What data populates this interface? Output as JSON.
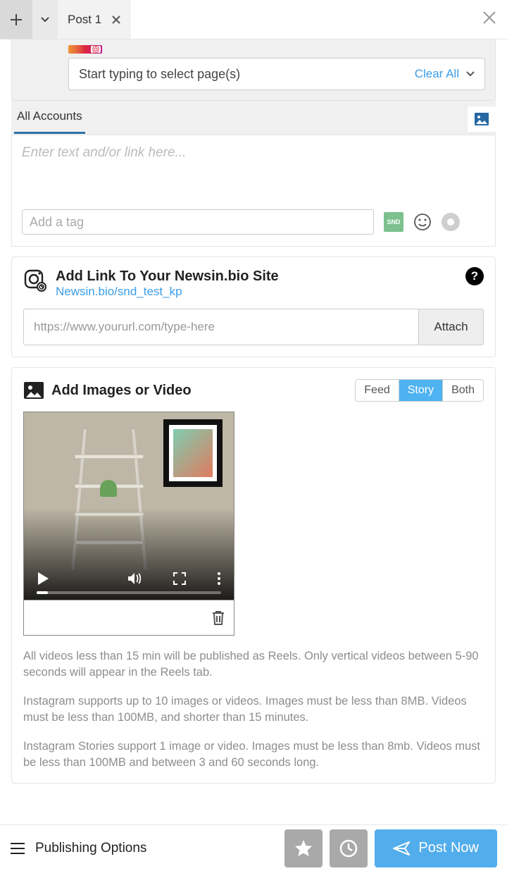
{
  "topbar": {
    "tab_label": "Post 1"
  },
  "page_selector": {
    "placeholder": "Start typing to select page(s)",
    "clear_label": "Clear All"
  },
  "tabs": {
    "all_accounts": "All Accounts"
  },
  "composer": {
    "placeholder": "Enter text and/or link here...",
    "tag_placeholder": "Add a tag",
    "snd_badge": "SND"
  },
  "link_card": {
    "title": "Add Link To Your Newsin.bio Site",
    "link_text": "Newsin.bio/snd_test_kp",
    "url_placeholder": "https://www.yoururl.com/type-here",
    "attach_label": "Attach"
  },
  "media_card": {
    "title": "Add Images or Video",
    "seg": {
      "feed": "Feed",
      "story": "Story",
      "both": "Both",
      "active": "story"
    },
    "notes": [
      "All videos less than 15 min will be published as Reels. Only vertical videos between 5-90 seconds will appear in the Reels tab.",
      "Instagram supports up to 10 images or videos. Images must be less than 8MB. Videos must be less than 100MB, and shorter than 15 minutes.",
      "Instagram Stories support 1 image or video. Images must be less than 8mb. Videos must be less than 100MB and between 3 and 60 seconds long."
    ]
  },
  "bottom": {
    "publishing_options": "Publishing Options",
    "post_now": "Post Now"
  }
}
